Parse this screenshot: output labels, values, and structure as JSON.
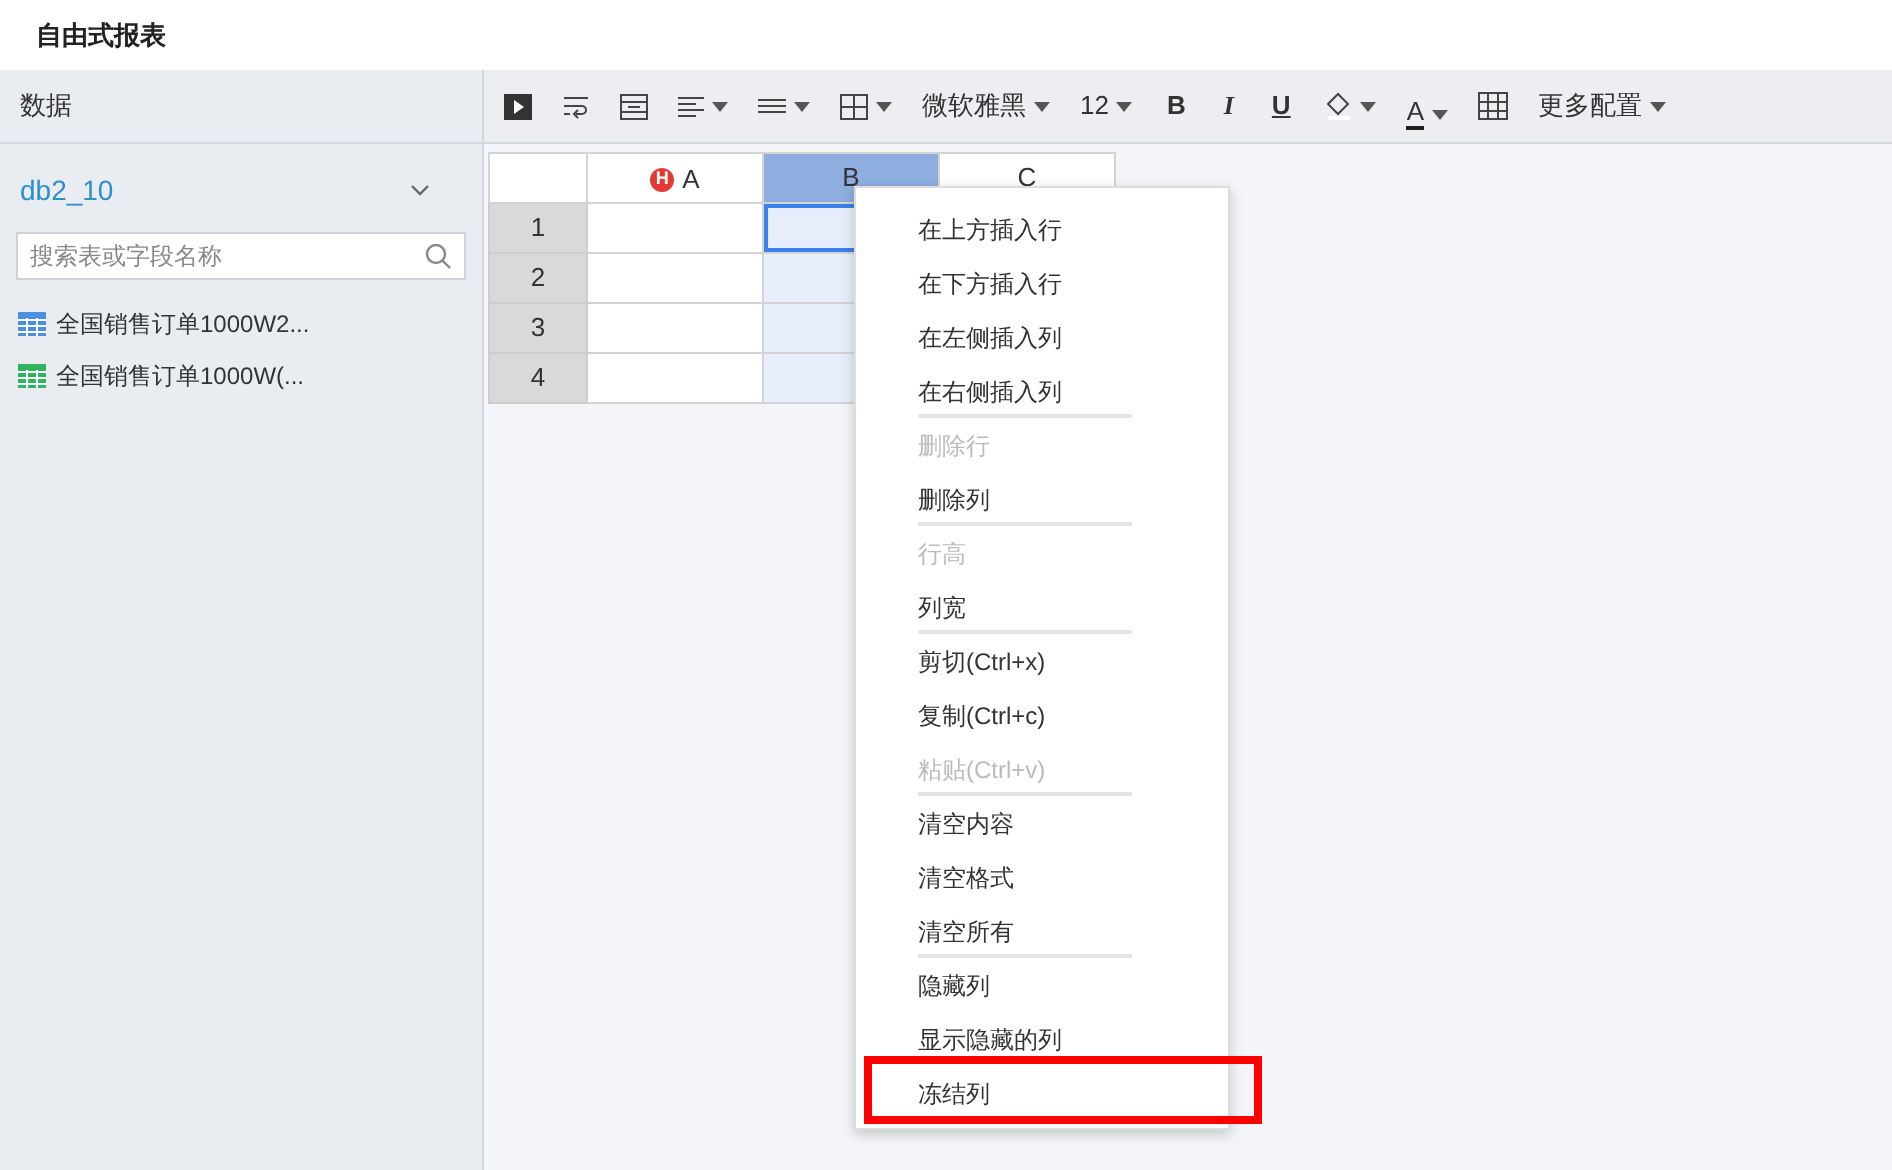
{
  "page_title": "自由式报表",
  "sidebar": {
    "header": "数据",
    "database": "db2_10",
    "search": {
      "placeholder": "搜索表或字段名称"
    },
    "tables": [
      {
        "label": "全国销售订单1000W2...",
        "color": "#4a8fe0"
      },
      {
        "label": "全国销售订单1000W(...",
        "color": "#2fb561"
      }
    ]
  },
  "toolbar": {
    "font": "微软雅黑",
    "font_size": "12",
    "bold": "B",
    "italic": "I",
    "underline": "U",
    "font_color": "A",
    "more": "更多配置"
  },
  "grid": {
    "columns": [
      {
        "label": "A",
        "badge": "H",
        "selected": false
      },
      {
        "label": "B",
        "selected": true
      },
      {
        "label": "C",
        "selected": false
      }
    ],
    "rows": [
      {
        "label": "1",
        "selected": true
      },
      {
        "label": "2",
        "selected": false
      },
      {
        "label": "3",
        "selected": false
      },
      {
        "label": "4",
        "selected": false
      }
    ]
  },
  "context_menu": {
    "groups": [
      [
        {
          "label": "在上方插入行",
          "disabled": false,
          "highlighted": false
        },
        {
          "label": "在下方插入行",
          "disabled": false,
          "highlighted": false
        },
        {
          "label": "在左侧插入列",
          "disabled": false,
          "highlighted": false
        },
        {
          "label": "在右侧插入列",
          "disabled": false,
          "highlighted": false
        }
      ],
      [
        {
          "label": "删除行",
          "disabled": true,
          "highlighted": false
        },
        {
          "label": "删除列",
          "disabled": false,
          "highlighted": false
        }
      ],
      [
        {
          "label": "行高",
          "disabled": true,
          "highlighted": false
        },
        {
          "label": "列宽",
          "disabled": false,
          "highlighted": false
        }
      ],
      [
        {
          "label": "剪切(Ctrl+x)",
          "disabled": false,
          "highlighted": false
        },
        {
          "label": "复制(Ctrl+c)",
          "disabled": false,
          "highlighted": false
        },
        {
          "label": "粘贴(Ctrl+v)",
          "disabled": true,
          "highlighted": false
        }
      ],
      [
        {
          "label": "清空内容",
          "disabled": false,
          "highlighted": false
        },
        {
          "label": "清空格式",
          "disabled": false,
          "highlighted": false
        },
        {
          "label": "清空所有",
          "disabled": false,
          "highlighted": false
        }
      ],
      [
        {
          "label": "隐藏列",
          "disabled": false,
          "highlighted": false
        },
        {
          "label": "显示隐藏的列",
          "disabled": false,
          "highlighted": false
        },
        {
          "label": "冻结列",
          "disabled": false,
          "highlighted": true
        }
      ]
    ]
  }
}
